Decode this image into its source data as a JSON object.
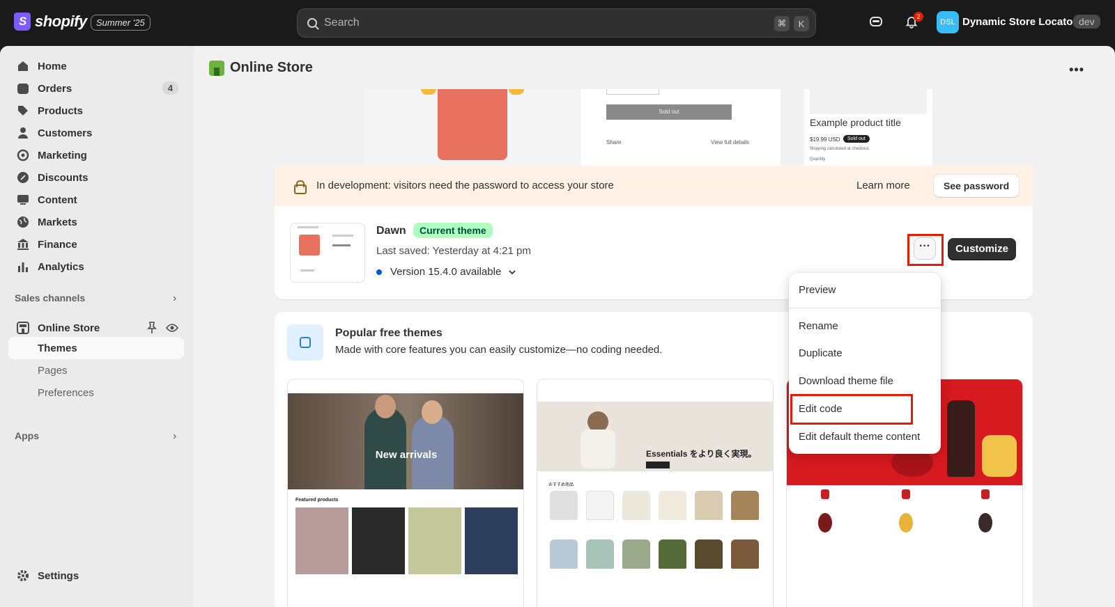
{
  "topbar": {
    "logo_text": "shopify",
    "edition": "Summer '25",
    "search_placeholder": "Search",
    "shortcut_cmd": "⌘",
    "shortcut_key": "K",
    "notification_count": "2",
    "store_initials": "DSL",
    "store_name": "Dynamic Store Locator",
    "store_tag": "dev"
  },
  "sidebar": {
    "items": [
      {
        "label": "Home",
        "icon": "home-icon"
      },
      {
        "label": "Orders",
        "icon": "orders-icon",
        "count": "4"
      },
      {
        "label": "Products",
        "icon": "tag-icon"
      },
      {
        "label": "Customers",
        "icon": "person-icon"
      },
      {
        "label": "Marketing",
        "icon": "target-icon"
      },
      {
        "label": "Discounts",
        "icon": "discount-icon"
      },
      {
        "label": "Content",
        "icon": "content-icon"
      },
      {
        "label": "Markets",
        "icon": "globe-icon"
      },
      {
        "label": "Finance",
        "icon": "bank-icon"
      },
      {
        "label": "Analytics",
        "icon": "chart-icon"
      }
    ],
    "sales_channels_label": "Sales channels",
    "online_store_label": "Online Store",
    "sub_items": [
      "Themes",
      "Pages",
      "Preferences"
    ],
    "apps_label": "Apps",
    "settings_label": "Settings"
  },
  "page": {
    "title": "Online Store"
  },
  "preview": {
    "sold_out": "Sold out",
    "share": "Share",
    "view_full": "View full details",
    "example_title": "Example product title",
    "price": "$19.99 USD",
    "sold_badge": "Sold out",
    "shipping": "Shipping calculated at checkout.",
    "quantity": "Quantity"
  },
  "banner": {
    "text": "In development: visitors need the password to access your store",
    "learn_more": "Learn more",
    "see_password": "See password"
  },
  "theme": {
    "name": "Dawn",
    "badge": "Current theme",
    "last_saved": "Last saved: Yesterday at 4:21 pm",
    "version": "Version 15.4.0 available",
    "customize": "Customize"
  },
  "menu": {
    "items": [
      "Preview",
      "Rename",
      "Duplicate",
      "Download theme file",
      "Edit code",
      "Edit default theme content"
    ]
  },
  "free_themes": {
    "title": "Popular free themes",
    "subtitle": "Made with core features you can easily customize—no coding needed.",
    "horizon_hero": "New arrivals",
    "horizon_featured": "Featured products",
    "jp_hero": "Essentials をより良く実現。",
    "jp_section": "おすすめ商品"
  }
}
